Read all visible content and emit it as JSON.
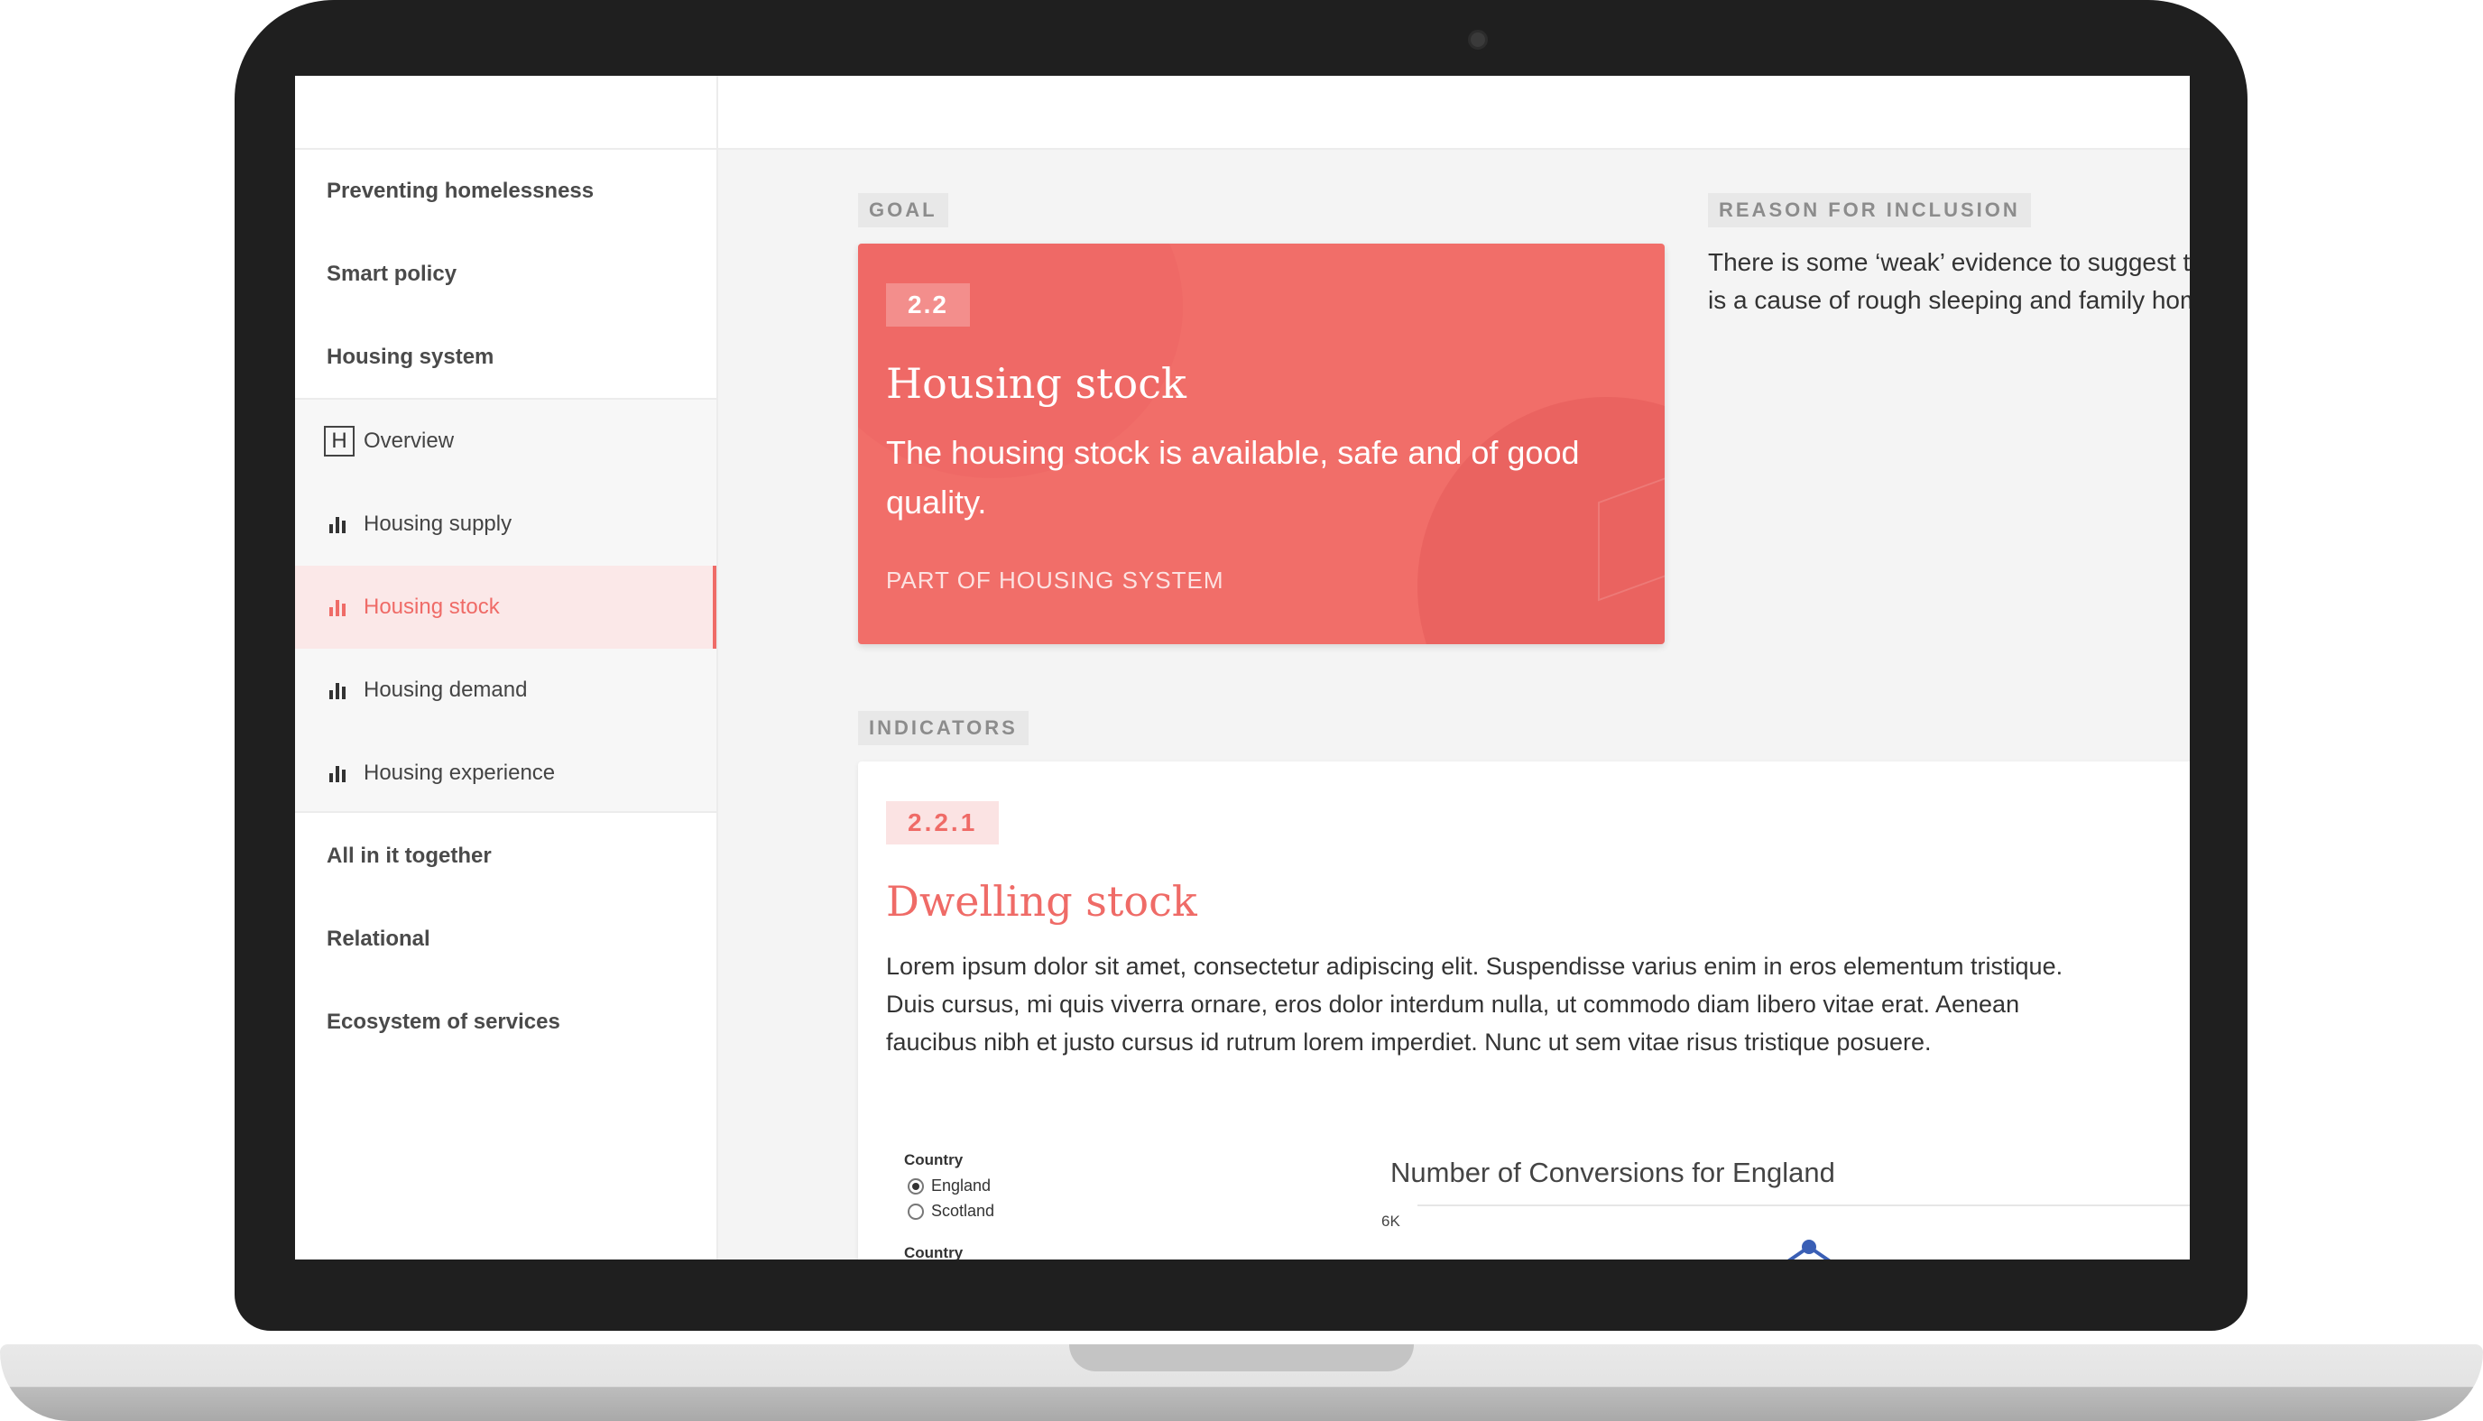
{
  "sidebar": {
    "top_items": [
      "Preventing homelessness",
      "Smart policy",
      "Housing system"
    ],
    "sub_items": [
      {
        "label": "Overview",
        "icon": "h-icon"
      },
      {
        "label": "Housing supply",
        "icon": "bar-chart-icon"
      },
      {
        "label": "Housing stock",
        "icon": "bar-chart-icon",
        "active": true
      },
      {
        "label": "Housing demand",
        "icon": "bar-chart-icon"
      },
      {
        "label": "Housing experience",
        "icon": "bar-chart-icon"
      }
    ],
    "bottom_items": [
      "All in it together",
      "Relational",
      "Ecosystem of services"
    ]
  },
  "goal": {
    "section_label": "GOAL",
    "badge": "2.2",
    "title": "Housing stock",
    "description": "The housing stock is available, safe and of good quality.",
    "part_of": "PART OF HOUSING SYSTEM"
  },
  "reason": {
    "section_label": "REASON FOR INCLUSION",
    "line1": "There is some ‘weak’ evidence to suggest th",
    "line2": "is a cause of rough sleeping and family hom"
  },
  "indicators": {
    "section_label": "INDICATORS",
    "badge": "2.2.1",
    "title": "Dwelling stock",
    "description": "Lorem ipsum dolor sit amet, consectetur adipiscing elit. Suspendisse varius enim in eros elementum tristique. Duis cursus, mi quis viverra ornare, eros dolor interdum nulla, ut commodo diam libero vitae erat. Aenean faucibus nibh et justo cursus id rutrum lorem imperdiet. Nunc ut sem vitae risus tristique posuere.",
    "filter_label_1": "Country",
    "filter_options": [
      {
        "label": "England",
        "checked": true
      },
      {
        "label": "Scotland",
        "checked": false
      }
    ],
    "filter_label_2": "Country",
    "chart_title": "Number of Conversions for England",
    "chart_tick": "6K"
  },
  "colors": {
    "accent": "#f16e69",
    "accent_text": "#ef6b67",
    "chart_line": "#3a5fb5"
  }
}
